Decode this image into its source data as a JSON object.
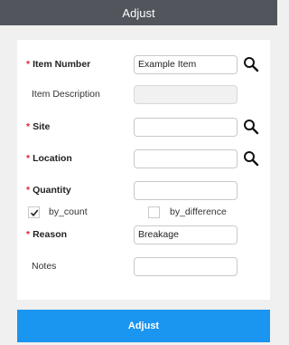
{
  "header": {
    "title": "Adjust"
  },
  "form": {
    "item_number": {
      "label": "Item Number",
      "required": "*",
      "value": "Example Item"
    },
    "item_description": {
      "label": "Item Description",
      "value": ""
    },
    "site": {
      "label": "Site",
      "required": "*",
      "value": ""
    },
    "location": {
      "label": "Location",
      "required": "*",
      "value": ""
    },
    "quantity": {
      "label": "Quantity",
      "required": "*",
      "value": ""
    },
    "by_count": {
      "label": "by_count",
      "checked": true
    },
    "by_difference": {
      "label": "by_difference",
      "checked": false
    },
    "reason": {
      "label": "Reason",
      "required": "*",
      "value": "Breakage"
    },
    "notes": {
      "label": "Notes",
      "value": ""
    }
  },
  "icons": {
    "lookup": "search-icon",
    "check": "checkmark-icon"
  },
  "colors": {
    "header_bg": "#52565c",
    "accent": "#1a95f0",
    "required": "#e0242a"
  },
  "actions": {
    "adjust_label": "Adjust"
  }
}
